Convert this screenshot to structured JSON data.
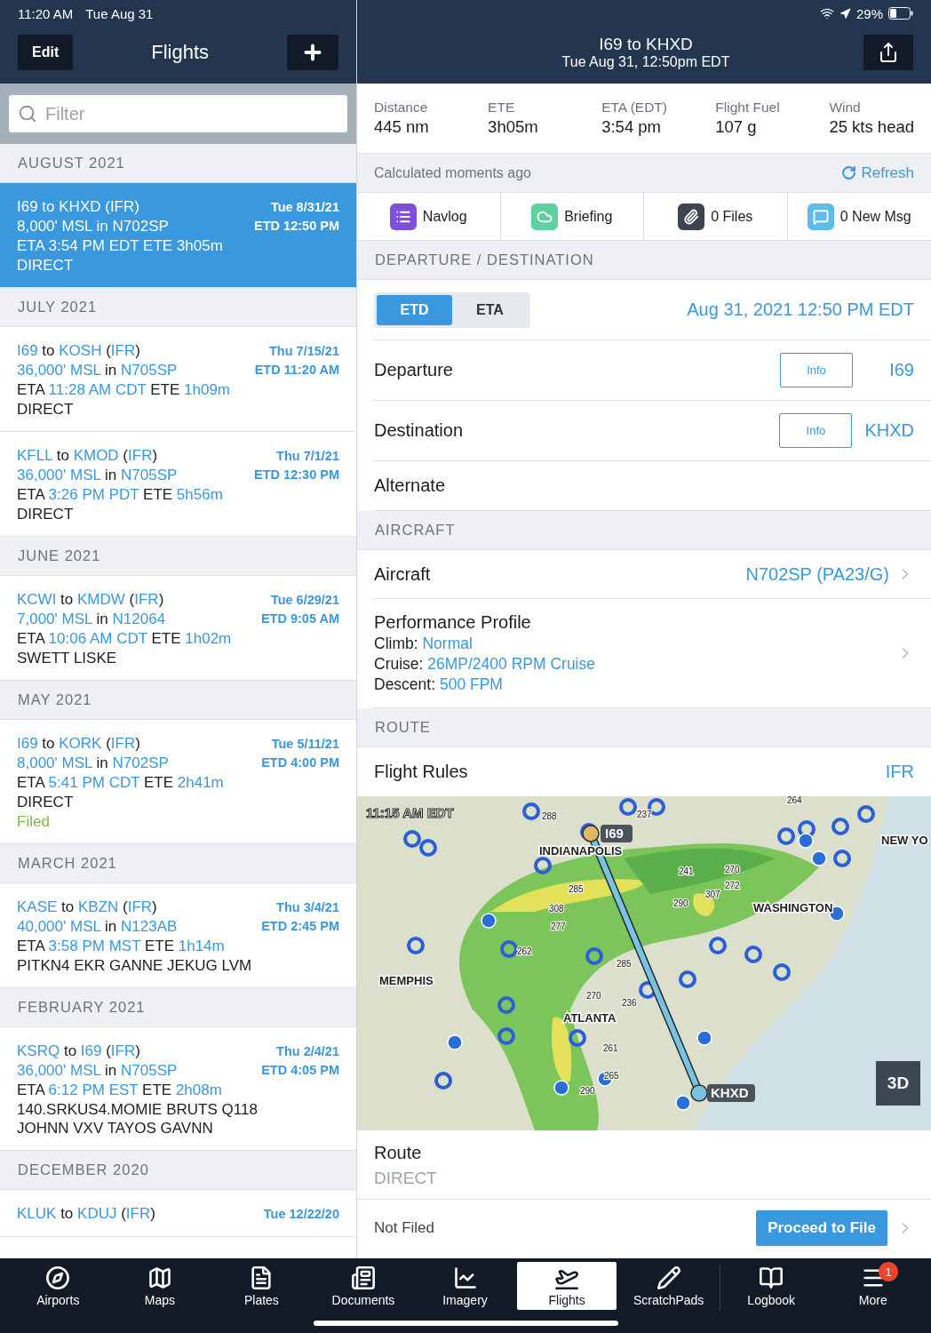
{
  "status_bar": {
    "time": "11:20 AM",
    "date": "Tue Aug 31",
    "battery": "29%"
  },
  "sidebar": {
    "edit_button": "Edit",
    "title": "Flights",
    "filter": {
      "placeholder": "Filter"
    },
    "sections": [
      {
        "heading": "AUGUST 2021",
        "flights": [
          {
            "selected": true,
            "date": "Tue 8/31/21",
            "etd": "ETD 12:50 PM",
            "lines": [
              [
                {
                  "text": "I69",
                  "kind": "link"
                },
                {
                  "text": " to ",
                  "kind": "plain"
                },
                {
                  "text": "KHXD",
                  "kind": "link"
                },
                {
                  "text": " (",
                  "kind": "plain"
                },
                {
                  "text": "IFR",
                  "kind": "link"
                },
                {
                  "text": ")",
                  "kind": "plain"
                }
              ],
              [
                {
                  "text": "8,000' MSL",
                  "kind": "link"
                },
                {
                  "text": " in ",
                  "kind": "plain"
                },
                {
                  "text": "N702SP",
                  "kind": "link"
                }
              ],
              [
                {
                  "text": "ETA ",
                  "kind": "plain"
                },
                {
                  "text": "3:54 PM EDT",
                  "kind": "link"
                },
                {
                  "text": " ETE ",
                  "kind": "plain"
                },
                {
                  "text": "3h05m",
                  "kind": "link"
                }
              ],
              [
                {
                  "text": "DIRECT",
                  "kind": "plain"
                }
              ]
            ]
          }
        ]
      },
      {
        "heading": "JULY 2021",
        "flights": [
          {
            "selected": false,
            "date": "Thu 7/15/21",
            "etd": "ETD 11:20 AM",
            "lines": [
              [
                {
                  "text": "I69",
                  "kind": "link"
                },
                {
                  "text": " to ",
                  "kind": "plain"
                },
                {
                  "text": "KOSH",
                  "kind": "link"
                },
                {
                  "text": " (",
                  "kind": "plain"
                },
                {
                  "text": "IFR",
                  "kind": "link"
                },
                {
                  "text": ")",
                  "kind": "plain"
                }
              ],
              [
                {
                  "text": "36,000' MSL",
                  "kind": "link"
                },
                {
                  "text": " in ",
                  "kind": "plain"
                },
                {
                  "text": "N705SP",
                  "kind": "link"
                }
              ],
              [
                {
                  "text": "ETA ",
                  "kind": "plain"
                },
                {
                  "text": "11:28 AM CDT",
                  "kind": "link"
                },
                {
                  "text": " ETE ",
                  "kind": "plain"
                },
                {
                  "text": "1h09m",
                  "kind": "link"
                }
              ],
              [
                {
                  "text": "DIRECT",
                  "kind": "plain"
                }
              ]
            ]
          },
          {
            "selected": false,
            "date": "Thu 7/1/21",
            "etd": "ETD 12:30 PM",
            "lines": [
              [
                {
                  "text": "KFLL",
                  "kind": "link"
                },
                {
                  "text": " to ",
                  "kind": "plain"
                },
                {
                  "text": "KMOD",
                  "kind": "link"
                },
                {
                  "text": " (",
                  "kind": "plain"
                },
                {
                  "text": "IFR",
                  "kind": "link"
                },
                {
                  "text": ")",
                  "kind": "plain"
                }
              ],
              [
                {
                  "text": "36,000' MSL",
                  "kind": "link"
                },
                {
                  "text": " in ",
                  "kind": "plain"
                },
                {
                  "text": "N705SP",
                  "kind": "link"
                }
              ],
              [
                {
                  "text": "ETA ",
                  "kind": "plain"
                },
                {
                  "text": "3:26 PM PDT",
                  "kind": "link"
                },
                {
                  "text": " ETE ",
                  "kind": "plain"
                },
                {
                  "text": "5h56m",
                  "kind": "link"
                }
              ],
              [
                {
                  "text": "DIRECT",
                  "kind": "plain"
                }
              ]
            ]
          }
        ]
      },
      {
        "heading": "JUNE 2021",
        "flights": [
          {
            "selected": false,
            "date": "Tue 6/29/21",
            "etd": "ETD 9:05 AM",
            "lines": [
              [
                {
                  "text": "KCWI",
                  "kind": "link"
                },
                {
                  "text": " to ",
                  "kind": "plain"
                },
                {
                  "text": "KMDW",
                  "kind": "link"
                },
                {
                  "text": " (",
                  "kind": "plain"
                },
                {
                  "text": "IFR",
                  "kind": "link"
                },
                {
                  "text": ")",
                  "kind": "plain"
                }
              ],
              [
                {
                  "text": "7,000' MSL",
                  "kind": "link"
                },
                {
                  "text": " in ",
                  "kind": "plain"
                },
                {
                  "text": "N12064",
                  "kind": "link"
                }
              ],
              [
                {
                  "text": "ETA ",
                  "kind": "plain"
                },
                {
                  "text": "10:06 AM CDT",
                  "kind": "link"
                },
                {
                  "text": " ETE ",
                  "kind": "plain"
                },
                {
                  "text": "1h02m",
                  "kind": "link"
                }
              ],
              [
                {
                  "text": "SWETT LISKE",
                  "kind": "plain"
                }
              ]
            ]
          }
        ]
      },
      {
        "heading": "MAY 2021",
        "flights": [
          {
            "selected": false,
            "date": "Tue 5/11/21",
            "etd": "ETD 4:00 PM",
            "lines": [
              [
                {
                  "text": "I69",
                  "kind": "link"
                },
                {
                  "text": " to ",
                  "kind": "plain"
                },
                {
                  "text": "KORK",
                  "kind": "link"
                },
                {
                  "text": " (",
                  "kind": "plain"
                },
                {
                  "text": "IFR",
                  "kind": "link"
                },
                {
                  "text": ")",
                  "kind": "plain"
                }
              ],
              [
                {
                  "text": "8,000' MSL",
                  "kind": "link"
                },
                {
                  "text": " in ",
                  "kind": "plain"
                },
                {
                  "text": "N702SP",
                  "kind": "link"
                }
              ],
              [
                {
                  "text": "ETA ",
                  "kind": "plain"
                },
                {
                  "text": "5:41 PM CDT",
                  "kind": "link"
                },
                {
                  "text": " ETE ",
                  "kind": "plain"
                },
                {
                  "text": "2h41m",
                  "kind": "link"
                }
              ],
              [
                {
                  "text": "DIRECT",
                  "kind": "plain"
                }
              ],
              [
                {
                  "text": "Filed",
                  "kind": "status"
                }
              ]
            ]
          }
        ]
      },
      {
        "heading": "MARCH 2021",
        "flights": [
          {
            "selected": false,
            "date": "Thu 3/4/21",
            "etd": "ETD 2:45 PM",
            "lines": [
              [
                {
                  "text": "KASE",
                  "kind": "link"
                },
                {
                  "text": " to ",
                  "kind": "plain"
                },
                {
                  "text": "KBZN",
                  "kind": "link"
                },
                {
                  "text": " (",
                  "kind": "plain"
                },
                {
                  "text": "IFR",
                  "kind": "link"
                },
                {
                  "text": ")",
                  "kind": "plain"
                }
              ],
              [
                {
                  "text": "40,000' MSL",
                  "kind": "link"
                },
                {
                  "text": " in ",
                  "kind": "plain"
                },
                {
                  "text": "N123AB",
                  "kind": "link"
                }
              ],
              [
                {
                  "text": "ETA ",
                  "kind": "plain"
                },
                {
                  "text": "3:58 PM MST",
                  "kind": "link"
                },
                {
                  "text": " ETE ",
                  "kind": "plain"
                },
                {
                  "text": "1h14m",
                  "kind": "link"
                }
              ],
              [
                {
                  "text": "PITKN4 EKR GANNE JEKUG LVM",
                  "kind": "plain"
                }
              ]
            ]
          }
        ]
      },
      {
        "heading": "FEBRUARY 2021",
        "flights": [
          {
            "selected": false,
            "date": "Thu 2/4/21",
            "etd": "ETD 4:05 PM",
            "lines": [
              [
                {
                  "text": "KSRQ",
                  "kind": "link"
                },
                {
                  "text": " to ",
                  "kind": "plain"
                },
                {
                  "text": "I69",
                  "kind": "link"
                },
                {
                  "text": " (",
                  "kind": "plain"
                },
                {
                  "text": "IFR",
                  "kind": "link"
                },
                {
                  "text": ")",
                  "kind": "plain"
                }
              ],
              [
                {
                  "text": "36,000' MSL",
                  "kind": "link"
                },
                {
                  "text": " in ",
                  "kind": "plain"
                },
                {
                  "text": "N705SP",
                  "kind": "link"
                }
              ],
              [
                {
                  "text": "ETA ",
                  "kind": "plain"
                },
                {
                  "text": "6:12 PM EST",
                  "kind": "link"
                },
                {
                  "text": " ETE ",
                  "kind": "plain"
                },
                {
                  "text": "2h08m",
                  "kind": "link"
                }
              ],
              [
                {
                  "text": "140.SRKUS4.MOMIE BRUTS Q118 JOHNN VXV TAYOS GAVNN",
                  "kind": "plain"
                }
              ]
            ]
          }
        ]
      },
      {
        "heading": "DECEMBER 2020",
        "flights": [
          {
            "selected": false,
            "date": "Tue 12/22/20",
            "lines": [
              [
                {
                  "text": "KLUK",
                  "kind": "link"
                },
                {
                  "text": " to ",
                  "kind": "plain"
                },
                {
                  "text": "KDUJ",
                  "kind": "link"
                },
                {
                  "text": " (",
                  "kind": "plain"
                },
                {
                  "text": "IFR",
                  "kind": "link"
                },
                {
                  "text": ")",
                  "kind": "plain"
                }
              ]
            ]
          }
        ]
      }
    ]
  },
  "detail": {
    "title": "I69 to KHXD",
    "subtitle": "Tue Aug 31, 12:50pm EDT",
    "stats": [
      {
        "label": "Distance",
        "value": "445 nm"
      },
      {
        "label": "ETE",
        "value": "3h05m"
      },
      {
        "label": "ETA (EDT)",
        "value": "3:54 pm"
      },
      {
        "label": "Flight Fuel",
        "value": "107 g"
      },
      {
        "label": "Wind",
        "value": "25 kts head"
      }
    ],
    "calculated": "Calculated moments ago",
    "refresh": "Refresh",
    "actions": [
      {
        "label": "Navlog",
        "kind": "navlog"
      },
      {
        "label": "Briefing",
        "kind": "briefing"
      },
      {
        "label": "0 Files",
        "kind": "files"
      },
      {
        "label": "0 New Msg",
        "kind": "messages"
      }
    ],
    "departure_destination": {
      "heading": "DEPARTURE / DESTINATION",
      "time_modes": [
        {
          "label": "ETD",
          "selected": true
        },
        {
          "label": "ETA",
          "selected": false
        }
      ],
      "datetime": "Aug 31, 2021 12:50 PM EDT",
      "rows": [
        {
          "label": "Departure",
          "info_button": "Info",
          "value": "I69"
        },
        {
          "label": "Destination",
          "info_button": "Info",
          "value": "KHXD"
        },
        {
          "label": "Alternate"
        }
      ]
    },
    "aircraft": {
      "heading": "AIRCRAFT",
      "label": "Aircraft",
      "value": "N702SP (PA23/G)",
      "performance": {
        "title": "Performance Profile",
        "lines": [
          {
            "label": "Climb: ",
            "value": "Normal"
          },
          {
            "label": "Cruise: ",
            "value": "26MP/2400 RPM Cruise"
          },
          {
            "label": "Descent: ",
            "value": "500 FPM"
          }
        ]
      }
    },
    "route": {
      "heading": "ROUTE",
      "flight_rules_label": "Flight Rules",
      "flight_rules": "IFR",
      "map": {
        "time": "11:15 AM EDT",
        "cities": [
          "INDIANAPOLIS",
          "NEW YO",
          "WASHINGTON",
          "MEMPHIS",
          "ATLANTA"
        ],
        "departure": "I69",
        "destination": "KHXD",
        "altitudes": [
          "288",
          "237",
          "264",
          "241",
          "270",
          "272",
          "285",
          "308",
          "307",
          "290",
          "277",
          "262",
          "285",
          "270",
          "236",
          "261",
          "290",
          "265"
        ],
        "view_button": "3D"
      },
      "route_label": "Route",
      "route_value": "DIRECT",
      "filing_status": "Not Filed",
      "file_button": "Proceed to File"
    }
  },
  "tab_bar": [
    {
      "label": "Airports",
      "kind": "airports",
      "selected": false
    },
    {
      "label": "Maps",
      "kind": "maps",
      "selected": false
    },
    {
      "label": "Plates",
      "kind": "plates",
      "selected": false
    },
    {
      "label": "Documents",
      "kind": "documents",
      "selected": false
    },
    {
      "label": "Imagery",
      "kind": "imagery",
      "selected": false
    },
    {
      "label": "Flights",
      "kind": "flights",
      "selected": true
    },
    {
      "label": "ScratchPads",
      "kind": "scratchpads",
      "selected": false
    },
    {
      "label": "Logbook",
      "kind": "logbook",
      "selected": false
    },
    {
      "label": "More",
      "kind": "more",
      "selected": false,
      "badge": "1"
    }
  ]
}
